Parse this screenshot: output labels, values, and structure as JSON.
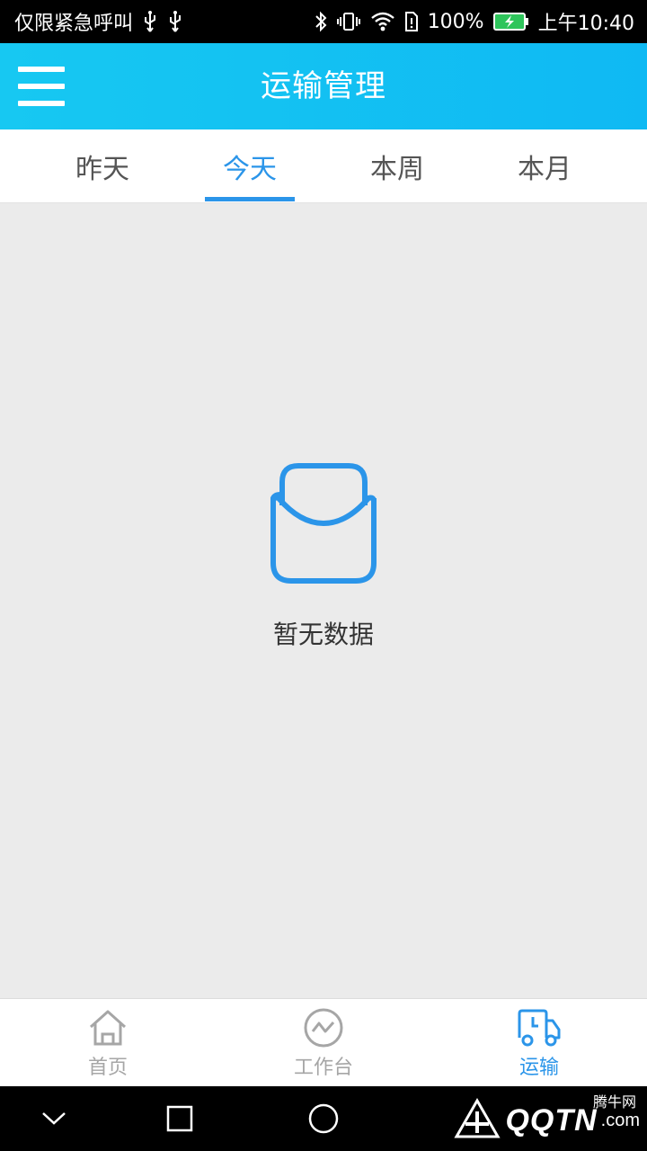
{
  "status_bar": {
    "carrier_text": "仅限紧急呼叫",
    "battery_percent": "100%",
    "time": "上午10:40",
    "icons": [
      "usb-icon",
      "usb-icon",
      "bluetooth-icon",
      "vibrate-icon",
      "wifi-icon",
      "sim-icon",
      "battery-charging-icon"
    ]
  },
  "header": {
    "title": "运输管理",
    "menu_icon": "hamburger-menu-icon"
  },
  "tabs": {
    "items": [
      {
        "label": "昨天"
      },
      {
        "label": "今天"
      },
      {
        "label": "本周"
      },
      {
        "label": "本月"
      }
    ],
    "active_index": 1
  },
  "content": {
    "empty_icon": "empty-inbox-icon",
    "empty_text": "暂无数据"
  },
  "bottom_nav": {
    "items": [
      {
        "label": "首页",
        "icon": "home-icon"
      },
      {
        "label": "工作台",
        "icon": "workbench-chart-icon"
      },
      {
        "label": "运输",
        "icon": "truck-icon"
      }
    ],
    "active_index": 2
  },
  "system_nav": {
    "buttons": [
      "back-chevron-icon",
      "recents-square-icon",
      "home-circle-icon"
    ]
  },
  "watermark": {
    "brand": "QQTN",
    "domain": ".com",
    "cn_name": "腾牛网"
  },
  "colors": {
    "accent": "#2b95e9",
    "header_bg": "#17c8f2",
    "inactive": "#a6a6a6",
    "content_bg": "#ebebeb"
  }
}
